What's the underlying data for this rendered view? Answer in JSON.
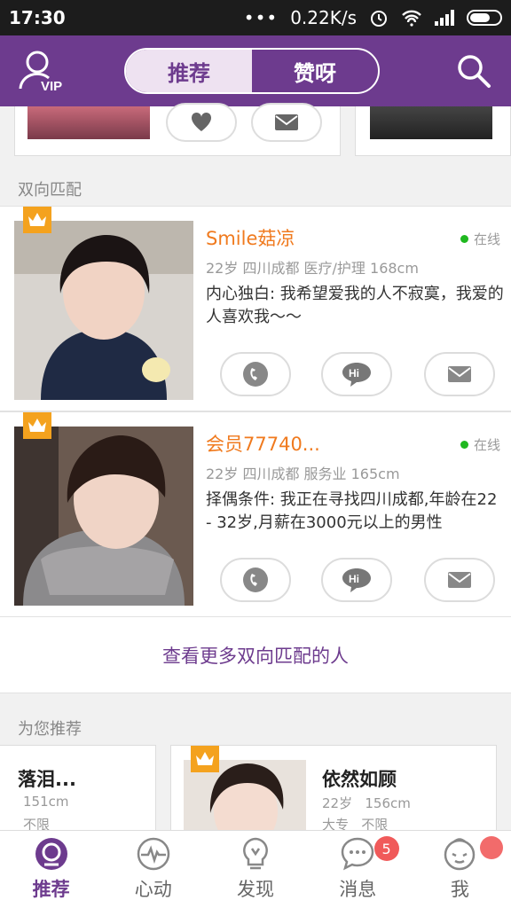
{
  "status_bar": {
    "time": "17:30",
    "network_speed": "0.22K/s"
  },
  "header": {
    "vip_label": "VIP",
    "tabs": [
      {
        "label": "推荐",
        "active": true
      },
      {
        "label": "赞呀",
        "active": false
      }
    ],
    "accent_color": "#6d3b8e"
  },
  "mutual_section": {
    "title": "双向匹配",
    "matches": [
      {
        "name": "Smile菇凉",
        "status": "在线",
        "info": "22岁  四川成都 医疗/护理 168cm",
        "bio": "内心独白: 我希望爱我的人不寂寞，我爱的人喜欢我～～"
      },
      {
        "name": "会员77740...",
        "status": "在线",
        "info": "22岁  四川成都 服务业 165cm",
        "bio": "择偶条件: 我正在寻找四川成都,年龄在22 - 32岁,月薪在3000元以上的男性"
      }
    ],
    "hi_label": "Hi",
    "more_link": "查看更多双向匹配的人"
  },
  "recommend_section": {
    "title": "为您推荐",
    "cards": [
      {
        "name": "落泪...",
        "line1": "151cm",
        "line2": "不限"
      },
      {
        "name": "依然如顾",
        "line1": "22岁   156cm",
        "line2": "大专   不限"
      }
    ]
  },
  "tabbar": {
    "items": [
      {
        "label": "推荐",
        "icon": "recommend-icon",
        "active": true
      },
      {
        "label": "心动",
        "icon": "heartbeat-icon",
        "active": false
      },
      {
        "label": "发现",
        "icon": "lightbulb-icon",
        "active": false
      },
      {
        "label": "消息",
        "icon": "chat-bubble-icon",
        "active": false,
        "badge": "5"
      },
      {
        "label": "我",
        "icon": "profile-face-icon",
        "active": false
      }
    ]
  }
}
